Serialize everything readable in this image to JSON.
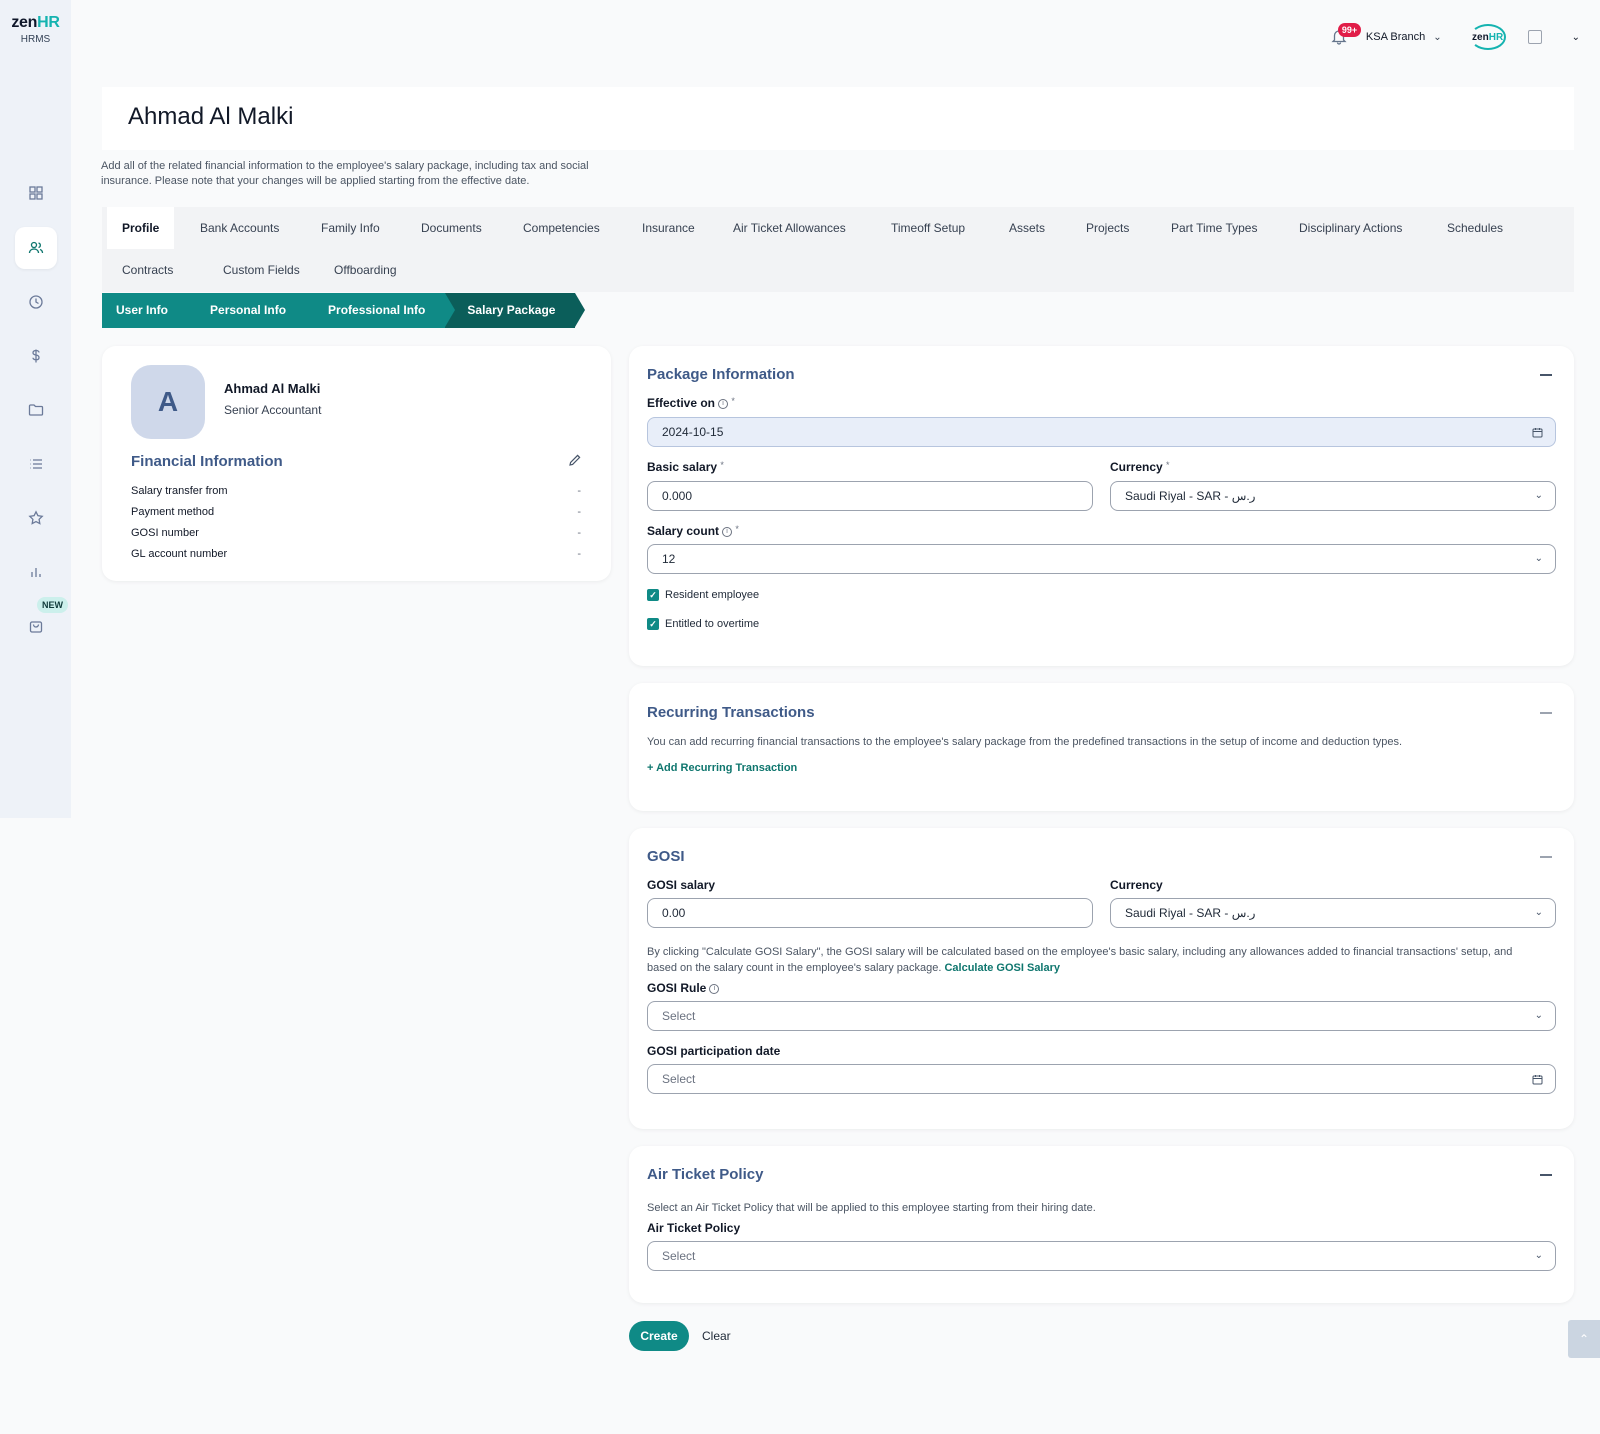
{
  "app": {
    "logo_main": "zen",
    "logo_hr": "HR",
    "logo_sub": "HRMS",
    "new_badge": "NEW"
  },
  "topbar": {
    "notifications": "99+",
    "branch": "KSA Branch",
    "brand_main": "zen",
    "brand_hr": "HR"
  },
  "header": {
    "name": "Ahmad Al Malki",
    "description": "Add all of the related financial information to the employee's salary package, including tax and social insurance. Please note that your changes will be applied starting from the effective date."
  },
  "tabs": [
    "Profile",
    "Bank Accounts",
    "Family Info",
    "Documents",
    "Competencies",
    "Insurance",
    "Air Ticket Allowances",
    "Timeoff Setup",
    "Assets",
    "Projects",
    "Part Time Types",
    "Disciplinary Actions",
    "Schedules",
    "Contracts",
    "Custom Fields",
    "Offboarding"
  ],
  "steps": [
    "User Info",
    "Personal Info",
    "Professional Info",
    "Salary Package"
  ],
  "profile": {
    "initial": "A",
    "name": "Ahmad Al Malki",
    "title": "Senior Accountant",
    "fin_title": "Financial Information",
    "rows": [
      {
        "label": "Salary transfer from",
        "value": "-"
      },
      {
        "label": "Payment method",
        "value": "-"
      },
      {
        "label": "GOSI number",
        "value": "-"
      },
      {
        "label": "GL account number",
        "value": "-"
      }
    ]
  },
  "package": {
    "title": "Package Information",
    "effective_label": "Effective on",
    "effective_value": "2024-10-15",
    "basic_label": "Basic salary",
    "basic_value": "0.000",
    "currency_label": "Currency",
    "currency_value": "Saudi Riyal - SAR - ر.س",
    "count_label": "Salary count",
    "count_value": "12",
    "resident_label": "Resident employee",
    "overtime_label": "Entitled to overtime",
    "required_mark": "*"
  },
  "recurring": {
    "title": "Recurring Transactions",
    "desc": "You can add recurring financial transactions to the employee's salary package from the predefined transactions in the setup of income and deduction types.",
    "add_link": "+ Add Recurring Transaction"
  },
  "gosi": {
    "title": "GOSI",
    "salary_label": "GOSI salary",
    "salary_value": "0.00",
    "currency_label": "Currency",
    "currency_value": "Saudi Riyal - SAR - ر.س",
    "desc": "By clicking \"Calculate GOSI Salary\", the GOSI salary will be calculated based on the employee's basic salary, including any allowances added to financial transactions' setup, and based on the salary count in the employee's salary package.",
    "calc_link": "Calculate GOSI Salary",
    "rule_label": "GOSI Rule",
    "rule_placeholder": "Select",
    "date_label": "GOSI participation date",
    "date_placeholder": "Select"
  },
  "air_ticket": {
    "title": "Air Ticket Policy",
    "desc": "Select an Air Ticket Policy that will be applied to this employee starting from their hiring date.",
    "label": "Air Ticket Policy",
    "placeholder": "Select"
  },
  "actions": {
    "create": "Create",
    "clear": "Clear"
  }
}
